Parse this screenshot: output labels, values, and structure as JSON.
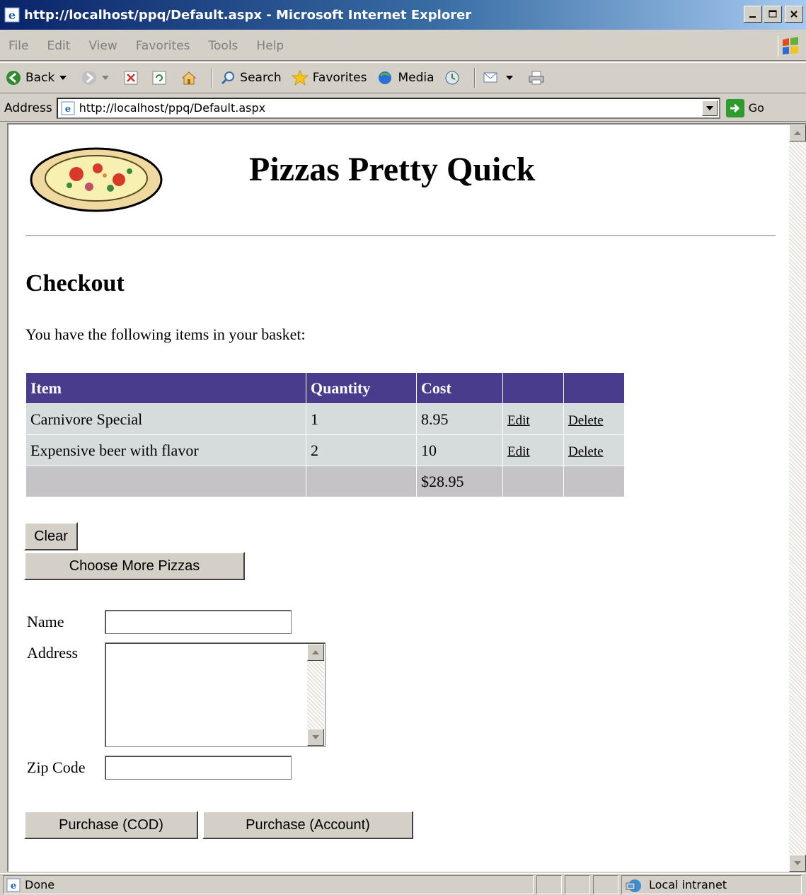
{
  "window": {
    "title": "http://localhost/ppq/Default.aspx - Microsoft Internet Explorer",
    "minimize": "_",
    "maximize": "□",
    "close": "×"
  },
  "menu": [
    "File",
    "Edit",
    "View",
    "Favorites",
    "Tools",
    "Help"
  ],
  "toolbar": {
    "back": "Back",
    "search": "Search",
    "favorites": "Favorites",
    "media": "Media"
  },
  "address": {
    "label": "Address",
    "url": "http://localhost/ppq/Default.aspx",
    "go": "Go"
  },
  "page": {
    "site_title": "Pizzas Pretty Quick",
    "heading": "Checkout",
    "intro": "You have the following items in your basket:",
    "table": {
      "headers": [
        "Item",
        "Quantity",
        "Cost",
        "",
        ""
      ],
      "rows": [
        {
          "item": "Carnivore Special",
          "quantity": "1",
          "cost": "8.95",
          "edit": "Edit",
          "delete": "Delete"
        },
        {
          "item": "Expensive beer with flavor",
          "quantity": "2",
          "cost": "10",
          "edit": "Edit",
          "delete": "Delete"
        }
      ],
      "total": "$28.95"
    },
    "buttons": {
      "clear": "Clear",
      "choose_more": "Choose More Pizzas",
      "purchase_cod": "Purchase (COD)",
      "purchase_account": "Purchase (Account)"
    },
    "form": {
      "name_label": "Name",
      "address_label": "Address",
      "zip_label": "Zip Code",
      "name_value": "",
      "address_value": "",
      "zip_value": ""
    }
  },
  "status": {
    "text": "Done",
    "zone": "Local intranet"
  },
  "colors": {
    "header_bg": "#4a3c8c",
    "row_bg": "#d6dbdc",
    "footer_bg": "#c6c3c6",
    "titlebar": "#0a246a"
  }
}
